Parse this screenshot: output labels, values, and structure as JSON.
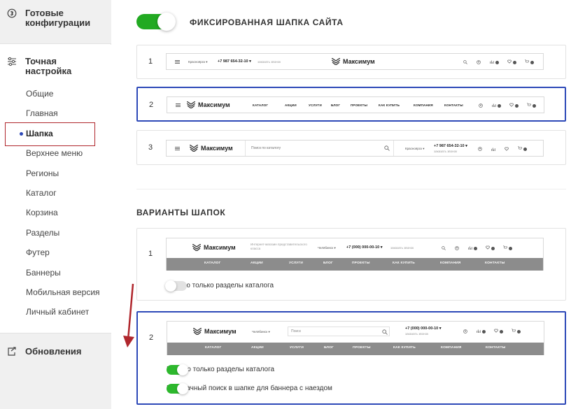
{
  "sidebar": {
    "ready_configs": "Готовые конфигурации",
    "fine_tuning": "Точная настройка",
    "items": [
      {
        "label": "Общие"
      },
      {
        "label": "Главная"
      },
      {
        "label": "Шапка"
      },
      {
        "label": "Верхнее меню"
      },
      {
        "label": "Регионы"
      },
      {
        "label": "Каталог"
      },
      {
        "label": "Корзина"
      },
      {
        "label": "Разделы"
      },
      {
        "label": "Футер"
      },
      {
        "label": "Баннеры"
      },
      {
        "label": "Мобильная версия"
      },
      {
        "label": "Личный кабинет"
      }
    ],
    "active_item": "Шапка",
    "updates": "Обновления"
  },
  "fixed_header": {
    "title": "ФИКСИРОВАННАЯ ШАПКА САЙТА",
    "enabled": true,
    "options": [
      {
        "num": "1",
        "city": "Красноярск ▾",
        "phone": "+7 987 654-32-10 ▾",
        "callback": "заказать звонок",
        "logo": "Максимум"
      },
      {
        "num": "2",
        "logo": "Максимум",
        "menu": [
          "КАТАЛОГ",
          "АКЦИИ",
          "УСЛУГИ",
          "БЛОГ",
          "ПРОЕКТЫ",
          "КАК КУПИТЬ",
          "КОМПАНИЯ",
          "КОНТАКТЫ"
        ]
      },
      {
        "num": "3",
        "logo": "Максимум",
        "search_placeholder": "Поиск по каталогу",
        "city": "Красноярск ▾",
        "phone": "+7 987 654-32-10 ▾",
        "callback": "заказать звонок"
      }
    ],
    "selected": "2"
  },
  "header_variants": {
    "title": "ВАРИАНТЫ ШАПОК",
    "options": [
      {
        "num": "1",
        "logo": "Максимум",
        "tagline": "Интернет-магазин представительского класса",
        "city": "Челябинск ▾",
        "phone": "+7 (000) 000-00-10 ▾",
        "callback": "заказать звонок",
        "menu": [
          "КАТАЛОГ",
          "АКЦИИ",
          "УСЛУГИ",
          "БЛОГ",
          "ПРОЕКТЫ",
          "КАК КУПИТЬ",
          "КОМПАНИЯ",
          "КОНТАКТЫ"
        ],
        "toggles": [
          {
            "label": "В меню только разделы каталога",
            "on": false
          }
        ]
      },
      {
        "num": "2",
        "logo": "Максимум",
        "city": "Челябинск ▾",
        "search_placeholder": "Поиск",
        "phone": "+7 (000) 000-00-10 ▾",
        "callback": "заказать звонок",
        "menu": [
          "КАТАЛОГ",
          "АКЦИИ",
          "УСЛУГИ",
          "БЛОГ",
          "ПРОЕКТЫ",
          "КАК КУПИТЬ",
          "КОМПАНИЯ",
          "КОНТАКТЫ"
        ],
        "toggles": [
          {
            "label": "В меню только разделы каталога",
            "on": true
          },
          {
            "label": "Прозрачный поиск в шапке для баннера с наездом",
            "on": true
          }
        ]
      }
    ],
    "selected": "2"
  },
  "colors": {
    "accent_blue": "#2d49b8",
    "highlight_red": "#b0272d",
    "toggle_green": "#2db82d",
    "menu_grey": "#8c8c8c"
  }
}
